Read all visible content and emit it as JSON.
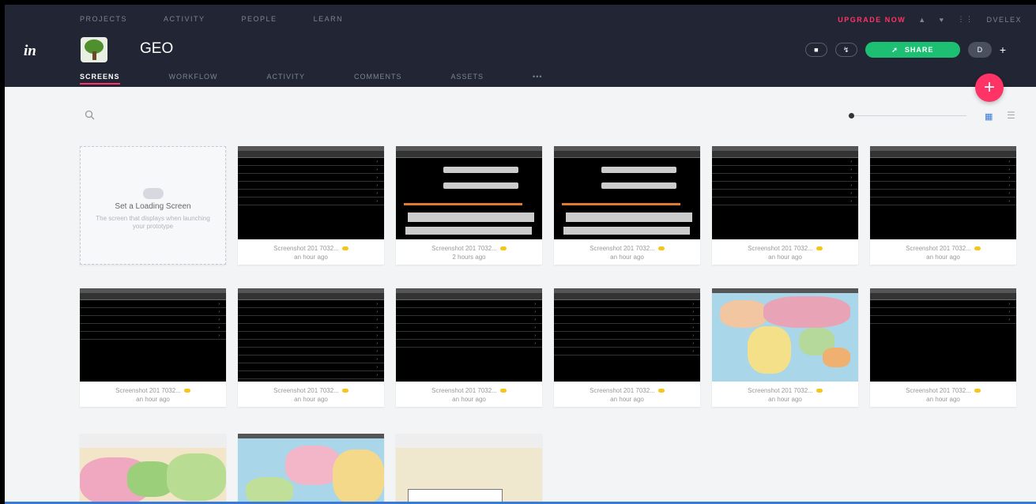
{
  "topnav": {
    "items": [
      "PROJECTS",
      "ACTIVITY",
      "PEOPLE",
      "LEARN"
    ],
    "upgrade": "UPGRADE NOW",
    "user": "DVELEX"
  },
  "header": {
    "logo": "in",
    "project_title": "GEO",
    "share_label": "SHARE",
    "avatar_initial": "D",
    "add_label": "+"
  },
  "tabs": [
    "SCREENS",
    "WORKFLOW",
    "ACTIVITY",
    "COMMENTS",
    "ASSETS",
    "•••"
  ],
  "fab_label": "+",
  "loading_card": {
    "title": "Set a Loading Screen",
    "description": "The screen that displays when launching your prototype"
  },
  "screens": [
    {
      "name": "Screenshot 201 7032...",
      "time": "an hour ago"
    },
    {
      "name": "Screenshot 201 7032...",
      "time": "2 hours ago"
    },
    {
      "name": "Screenshot 201 7032...",
      "time": "an hour ago"
    },
    {
      "name": "Screenshot 201 7032...",
      "time": "an hour ago"
    },
    {
      "name": "Screenshot 201 7032...",
      "time": "an hour ago"
    },
    {
      "name": "Screenshot 201 7032...",
      "time": "an hour ago"
    },
    {
      "name": "Screenshot 201 7032...",
      "time": "an hour ago"
    },
    {
      "name": "Screenshot 201 7032...",
      "time": "an hour ago"
    },
    {
      "name": "Screenshot 201 7032...",
      "time": "an hour ago"
    },
    {
      "name": "Screenshot 201 7032...",
      "time": "an hour ago"
    },
    {
      "name": "Screenshot 201 7032...",
      "time": "an hour ago"
    }
  ],
  "colors": {
    "accent": "#ff3366",
    "share": "#1dbf73",
    "nav_bg": "#222634"
  }
}
